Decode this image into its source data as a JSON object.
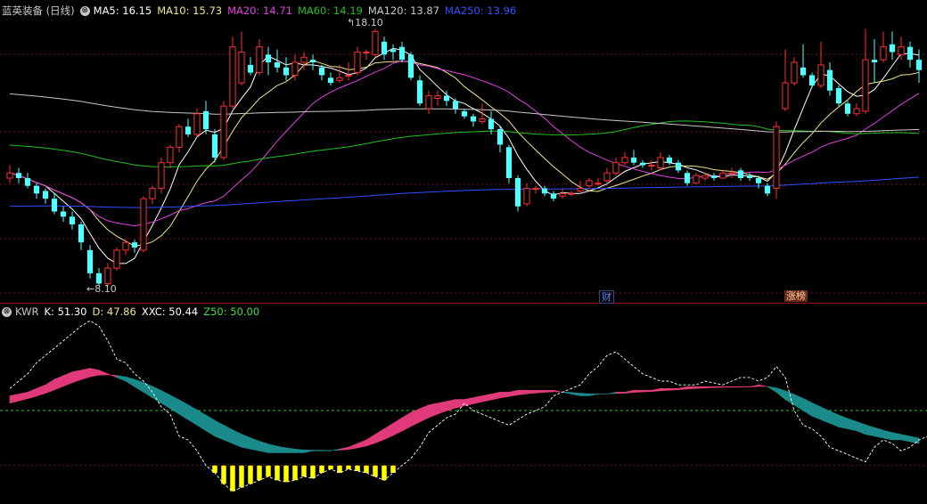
{
  "stock": {
    "title": "蓝英装备 (日线)"
  },
  "ma_legend": [
    {
      "label": "MA5: 16.15",
      "color": "#ffffff"
    },
    {
      "label": "MA10: 15.73",
      "color": "#f0e68c"
    },
    {
      "label": "MA20: 14.71",
      "color": "#e040e0"
    },
    {
      "label": "MA60: 14.19",
      "color": "#20c020"
    },
    {
      "label": "MA120: 13.87",
      "color": "#c8c8c8"
    },
    {
      "label": "MA250: 13.96",
      "color": "#3050ff"
    }
  ],
  "kwr_legend": [
    {
      "label": "KWR",
      "color": "#c8c8c8"
    },
    {
      "label": "K: 51.30",
      "color": "#ffffff"
    },
    {
      "label": "D: 47.86",
      "color": "#f0e68c"
    },
    {
      "label": "XXC: 50.44",
      "color": "#ffffff"
    },
    {
      "label": "Z50: 50.00",
      "color": "#40e040"
    }
  ],
  "markers": {
    "high": "18.10",
    "low": "8.10",
    "finance": "财",
    "limit_up": "涨榜"
  },
  "colors": {
    "up": "#ff3030",
    "down": "#54ffff",
    "pink": "#e03a7a",
    "teal": "#1a8a8a",
    "yellow": "#ffff00"
  },
  "chart_data": [
    {
      "type": "candlestick",
      "title": "蓝英装备 (日线)",
      "ylim": [
        7.8,
        18.6
      ],
      "candles": [
        [
          12.3,
          12.5,
          12.8,
          12.1
        ],
        [
          12.5,
          12.3,
          12.7,
          12.1
        ],
        [
          12.3,
          12.0,
          12.5,
          11.9
        ],
        [
          12.0,
          11.7,
          12.1,
          11.5
        ],
        [
          11.8,
          11.5,
          11.9,
          11.3
        ],
        [
          11.5,
          11.0,
          11.7,
          10.9
        ],
        [
          11.0,
          10.8,
          11.2,
          10.6
        ],
        [
          10.8,
          10.5,
          11.0,
          10.3
        ],
        [
          10.5,
          9.8,
          10.6,
          9.5
        ],
        [
          9.5,
          8.6,
          9.7,
          8.4
        ],
        [
          8.6,
          8.2,
          8.8,
          8.1
        ],
        [
          8.2,
          8.8,
          9.0,
          8.1
        ],
        [
          8.8,
          9.5,
          9.6,
          8.7
        ],
        [
          9.5,
          9.8,
          9.9,
          9.3
        ],
        [
          9.8,
          9.6,
          9.9,
          9.4
        ],
        [
          9.5,
          11.5,
          11.6,
          9.4
        ],
        [
          11.5,
          11.9,
          12.0,
          11.3
        ],
        [
          11.9,
          12.9,
          13.1,
          11.7
        ],
        [
          12.9,
          13.5,
          13.6,
          12.7
        ],
        [
          13.5,
          14.3,
          14.4,
          13.3
        ],
        [
          14.3,
          14.0,
          14.6,
          13.9
        ],
        [
          14.0,
          14.8,
          15.0,
          13.9
        ],
        [
          14.9,
          14.2,
          15.3,
          14.0
        ],
        [
          14.0,
          13.1,
          14.2,
          12.9
        ],
        [
          13.1,
          15.1,
          15.3,
          13.0
        ],
        [
          15.1,
          17.4,
          17.8,
          15.0
        ],
        [
          16.0,
          17.2,
          18.0,
          15.9
        ],
        [
          16.7,
          16.4,
          17.0,
          16.3
        ],
        [
          16.4,
          17.4,
          17.7,
          16.3
        ],
        [
          17.1,
          16.8,
          17.4,
          16.3
        ],
        [
          16.8,
          16.6,
          17.3,
          16.4
        ],
        [
          16.6,
          16.3,
          17.0,
          16.1
        ],
        [
          16.3,
          16.8,
          17.1,
          16.1
        ],
        [
          16.8,
          17.0,
          17.2,
          16.5
        ],
        [
          16.9,
          16.8,
          17.1,
          16.5
        ],
        [
          16.6,
          16.3,
          16.7,
          16.1
        ],
        [
          16.2,
          16.0,
          16.4,
          15.9
        ],
        [
          16.1,
          16.2,
          16.7,
          16.0
        ],
        [
          16.3,
          16.3,
          16.8,
          16.1
        ],
        [
          16.4,
          17.2,
          17.4,
          16.3
        ],
        [
          17.2,
          17.2,
          17.3,
          16.9
        ],
        [
          17.1,
          18.0,
          18.1,
          17.0
        ],
        [
          17.6,
          17.1,
          17.8,
          16.9
        ],
        [
          17.3,
          17.2,
          17.5,
          16.9
        ],
        [
          17.4,
          16.9,
          17.6,
          16.8
        ],
        [
          17.1,
          16.2,
          17.2,
          16.1
        ],
        [
          16.1,
          15.2,
          16.3,
          15.1
        ],
        [
          15.0,
          15.5,
          15.7,
          14.8
        ],
        [
          15.4,
          15.5,
          15.7,
          15.1
        ],
        [
          15.5,
          15.3,
          15.7,
          15.1
        ],
        [
          15.3,
          15.0,
          15.4,
          14.8
        ],
        [
          14.9,
          14.7,
          15.0,
          14.6
        ],
        [
          14.7,
          14.5,
          14.8,
          14.3
        ],
        [
          14.5,
          14.6,
          15.2,
          14.4
        ],
        [
          14.6,
          14.2,
          14.9,
          14.0
        ],
        [
          14.2,
          13.6,
          14.3,
          13.3
        ],
        [
          13.5,
          12.3,
          13.6,
          12.1
        ],
        [
          12.3,
          11.2,
          12.4,
          11.0
        ],
        [
          11.3,
          11.9,
          12.1,
          11.2
        ],
        [
          11.9,
          11.9,
          12.0,
          11.7
        ],
        [
          11.9,
          11.7,
          12.0,
          11.6
        ],
        [
          11.7,
          11.5,
          11.8,
          11.4
        ],
        [
          11.6,
          11.7,
          11.9,
          11.5
        ],
        [
          11.7,
          11.7,
          11.8,
          11.6
        ],
        [
          11.8,
          11.9,
          12.2,
          11.7
        ],
        [
          12.0,
          12.2,
          12.3,
          11.9
        ],
        [
          12.1,
          12.1,
          12.3,
          12.0
        ],
        [
          12.2,
          12.5,
          12.7,
          12.0
        ],
        [
          12.5,
          12.9,
          13.1,
          12.4
        ],
        [
          12.9,
          13.1,
          13.3,
          12.8
        ],
        [
          13.1,
          12.9,
          13.4,
          12.8
        ],
        [
          12.9,
          12.8,
          13.0,
          12.7
        ],
        [
          12.8,
          12.8,
          13.0,
          12.6
        ],
        [
          12.7,
          13.1,
          13.3,
          12.6
        ],
        [
          13.1,
          12.9,
          13.2,
          12.8
        ],
        [
          12.9,
          12.6,
          13.0,
          12.5
        ],
        [
          12.5,
          12.1,
          12.6,
          12.0
        ],
        [
          12.1,
          12.4,
          12.5,
          12.1
        ],
        [
          12.3,
          12.4,
          12.5,
          12.2
        ],
        [
          12.4,
          12.3,
          12.5,
          12.2
        ],
        [
          12.3,
          12.5,
          12.6,
          12.3
        ],
        [
          12.5,
          12.5,
          12.7,
          12.3
        ],
        [
          12.6,
          12.3,
          12.7,
          12.2
        ],
        [
          12.4,
          12.3,
          12.5,
          12.2
        ],
        [
          12.3,
          12.1,
          12.4,
          11.9
        ],
        [
          12.0,
          11.7,
          12.1,
          11.6
        ],
        [
          11.9,
          14.3,
          14.5,
          11.5
        ],
        [
          15.0,
          16.0,
          17.3,
          14.9
        ],
        [
          16.0,
          16.8,
          17.0,
          15.9
        ],
        [
          16.6,
          16.3,
          17.5,
          16.2
        ],
        [
          16.3,
          15.9,
          16.4,
          15.8
        ],
        [
          15.9,
          16.7,
          17.6,
          15.8
        ],
        [
          16.5,
          15.7,
          16.8,
          15.5
        ],
        [
          15.8,
          15.2,
          15.9,
          15.1
        ],
        [
          15.2,
          14.8,
          15.3,
          14.7
        ],
        [
          14.8,
          15.0,
          15.2,
          14.7
        ],
        [
          14.9,
          16.9,
          18.1,
          14.8
        ],
        [
          16.9,
          16.8,
          17.7,
          16.0
        ],
        [
          16.9,
          17.4,
          18.0,
          16.8
        ],
        [
          17.5,
          17.2,
          18.0,
          16.9
        ],
        [
          17.1,
          17.4,
          17.8,
          16.9
        ],
        [
          17.4,
          16.9,
          17.6,
          16.6
        ],
        [
          16.9,
          16.5,
          17.3,
          16.0
        ]
      ]
    },
    {
      "type": "line",
      "title": "KWR",
      "ylim": [
        0,
        100
      ],
      "xxc": [
        62,
        66,
        70,
        76,
        80,
        84,
        88,
        92,
        96,
        99,
        96,
        88,
        78,
        76,
        70,
        66,
        60,
        52,
        48,
        36,
        34,
        28,
        20,
        16,
        10,
        6,
        8,
        10,
        12,
        14,
        12,
        11,
        12,
        14,
        13,
        16,
        18,
        16,
        18,
        17,
        16,
        14,
        12,
        16,
        20,
        24,
        30,
        38,
        42,
        46,
        48,
        54,
        50,
        48,
        46,
        44,
        42,
        45,
        48,
        50,
        52,
        58,
        60,
        62,
        64,
        70,
        74,
        80,
        82,
        78,
        74,
        70,
        68,
        66,
        66,
        64,
        64,
        64,
        66,
        65,
        64,
        66,
        68,
        68,
        66,
        68,
        74,
        68,
        50,
        42,
        40,
        36,
        30,
        28,
        26,
        24,
        22,
        30,
        34,
        32,
        28,
        30,
        34,
        36
      ],
      "k": [
        58,
        59,
        60,
        62,
        64,
        67,
        69,
        71,
        72,
        73,
        72,
        70,
        68,
        66,
        63,
        60,
        57,
        54,
        51,
        48,
        45,
        42,
        39,
        36,
        34,
        32,
        30,
        29,
        28,
        27,
        27,
        27,
        27,
        27,
        28,
        28,
        28,
        29,
        30,
        32,
        34,
        37,
        40,
        43,
        46,
        49,
        51,
        53,
        54,
        55,
        56,
        56,
        57,
        58,
        59,
        60,
        60,
        61,
        61,
        61,
        61,
        61,
        60,
        59,
        58,
        58,
        59,
        59,
        60,
        60,
        61,
        61,
        61,
        62,
        62,
        62,
        63,
        63,
        63,
        63,
        63,
        63,
        63,
        63,
        64,
        63,
        60,
        56,
        53,
        50,
        47,
        45,
        43,
        41,
        40,
        39,
        37,
        36,
        35,
        34,
        34,
        33,
        32,
        31
      ]
    }
  ]
}
